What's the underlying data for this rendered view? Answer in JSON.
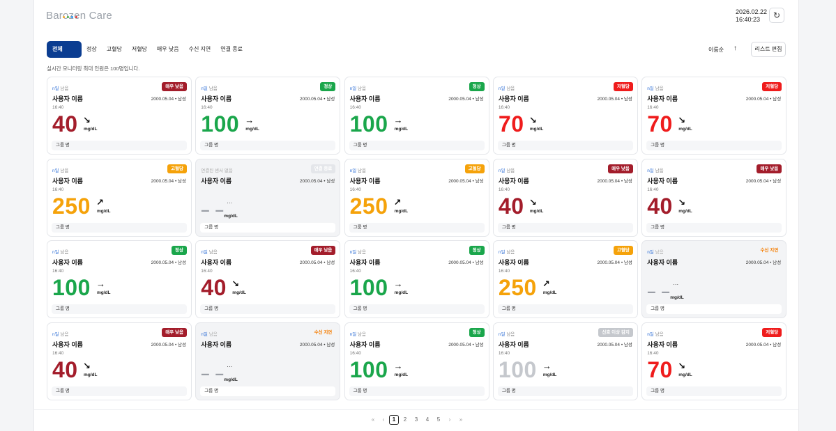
{
  "app": {
    "logo_text": "Barozen Care",
    "logo_dot_colors": [
      "#f5a623",
      "#4caf50",
      "#2196f3",
      "#e53935"
    ]
  },
  "header": {
    "date": "2026.02.22",
    "time": "16:40:23",
    "refresh_icon": "refresh-icon"
  },
  "tabs": [
    {
      "label": "전체",
      "active": true
    },
    {
      "label": "정상"
    },
    {
      "label": "고혈당"
    },
    {
      "label": "저혈당"
    },
    {
      "label": "매우 낮음"
    },
    {
      "label": "수신 지연"
    },
    {
      "label": "연결 종료"
    }
  ],
  "sort": {
    "label": "이름순",
    "direction_icon": "arrow-up-icon"
  },
  "edit_button": "리스트 편집",
  "notice": "실시간 모니터링 최대 인원은 100명입니다.",
  "colors": {
    "very_low": "#a31d2b",
    "normal": "#1aa64b",
    "low": "#ef1c1c",
    "high": "#f5a20a",
    "disconnected": "#cfd2d7",
    "delayed": "#f57c00",
    "out_of_range": "#c5c8cd"
  },
  "cards": [
    {
      "remain_n": "n일",
      "remain_t": "남음",
      "badge": "매우 낮음",
      "status": "very_low",
      "name": "사용자 이름",
      "birth": "2000.05.04 • 남성",
      "time": "16:40",
      "value": "40",
      "arrow": "↘",
      "unit": "mg/dL",
      "group": "그룹 명"
    },
    {
      "remain_n": "n일",
      "remain_t": "남음",
      "badge": "정상",
      "status": "normal",
      "name": "사용자 이름",
      "birth": "2000.05.04 • 남성",
      "time": "16:40",
      "value": "100",
      "arrow": "→",
      "unit": "mg/dL",
      "group": "그룹 명"
    },
    {
      "remain_n": "n일",
      "remain_t": "남음",
      "badge": "정상",
      "status": "normal",
      "name": "사용자 이름",
      "birth": "2000.05.04 • 남성",
      "time": "16:40",
      "value": "100",
      "arrow": "→",
      "unit": "mg/dL",
      "group": "그룹 명"
    },
    {
      "remain_n": "n일",
      "remain_t": "남음",
      "badge": "저혈당",
      "status": "low",
      "name": "사용자 이름",
      "birth": "2000.05.04 • 남성",
      "time": "16:40",
      "value": "70",
      "arrow": "↘",
      "unit": "mg/dL",
      "group": "그룹 명"
    },
    {
      "remain_n": "n일",
      "remain_t": "남음",
      "badge": "저혈당",
      "status": "low",
      "name": "사용자 이름",
      "birth": "2000.05.04 • 남성",
      "time": "16:40",
      "value": "70",
      "arrow": "↘",
      "unit": "mg/dL",
      "group": "그룹 명"
    },
    {
      "remain_n": "n일",
      "remain_t": "남음",
      "badge": "고혈당",
      "status": "high",
      "name": "사용자 이름",
      "birth": "2000.05.04 • 남성",
      "time": "16:40",
      "value": "250",
      "arrow": "↗",
      "unit": "mg/dL",
      "group": "그룹 명"
    },
    {
      "remain_n": "",
      "remain_t": "연결된 센서 없음",
      "badge": "연결 종료",
      "status": "disconnected",
      "name": "사용자 이름",
      "birth": "2000.05.04 • 남성",
      "time": "",
      "value": "",
      "dash": "– –",
      "arrow": "···",
      "unit": "mg/dL",
      "group": "그룹 명"
    },
    {
      "remain_n": "n일",
      "remain_t": "남음",
      "badge": "고혈당",
      "status": "high",
      "name": "사용자 이름",
      "birth": "2000.05.04 • 남성",
      "time": "16:40",
      "value": "250",
      "arrow": "↗",
      "unit": "mg/dL",
      "group": "그룹 명"
    },
    {
      "remain_n": "n일",
      "remain_t": "남음",
      "badge": "매우 낮음",
      "status": "very_low",
      "name": "사용자 이름",
      "birth": "2000.05.04 • 남성",
      "time": "16:40",
      "value": "40",
      "arrow": "↘",
      "unit": "mg/dL",
      "group": "그룹 명"
    },
    {
      "remain_n": "n일",
      "remain_t": "남음",
      "badge": "매우 낮음",
      "status": "very_low",
      "name": "사용자 이름",
      "birth": "2000.05.04 • 남성",
      "time": "16:40",
      "value": "40",
      "arrow": "↘",
      "unit": "mg/dL",
      "group": "그룹 명"
    },
    {
      "remain_n": "n일",
      "remain_t": "남음",
      "badge": "정상",
      "status": "normal",
      "name": "사용자 이름",
      "birth": "2000.05.04 • 남성",
      "time": "16:40",
      "value": "100",
      "arrow": "→",
      "unit": "mg/dL",
      "group": "그룹 명"
    },
    {
      "remain_n": "n일",
      "remain_t": "남음",
      "badge": "매우 낮음",
      "status": "very_low",
      "name": "사용자 이름",
      "birth": "2000.05.04 • 남성",
      "time": "16:40",
      "value": "40",
      "arrow": "↘",
      "unit": "mg/dL",
      "group": "그룹 명"
    },
    {
      "remain_n": "n일",
      "remain_t": "남음",
      "badge": "정상",
      "status": "normal",
      "name": "사용자 이름",
      "birth": "2000.05.04 • 남성",
      "time": "16:40",
      "value": "100",
      "arrow": "→",
      "unit": "mg/dL",
      "group": "그룹 명"
    },
    {
      "remain_n": "n일",
      "remain_t": "남음",
      "badge": "고혈당",
      "status": "high",
      "name": "사용자 이름",
      "birth": "2000.05.04 • 남성",
      "time": "16:40",
      "value": "250",
      "arrow": "↗",
      "unit": "mg/dL",
      "group": "그룹 명"
    },
    {
      "remain_n": "n일",
      "remain_t": "남음",
      "badge": "수신 지연",
      "status": "delayed",
      "name": "사용자 이름",
      "birth": "2000.05.04 • 남성",
      "time": "",
      "value": "",
      "dash": "– –",
      "arrow": "···",
      "unit": "mg/dL",
      "group": "그룹 명"
    },
    {
      "remain_n": "n일",
      "remain_t": "남음",
      "badge": "매우 낮음",
      "status": "very_low",
      "name": "사용자 이름",
      "birth": "2000.05.04 • 남성",
      "time": "16:40",
      "value": "40",
      "arrow": "↘",
      "unit": "mg/dL",
      "group": "그룹 명"
    },
    {
      "remain_n": "n일",
      "remain_t": "남음",
      "badge": "수신 지연",
      "status": "delayed",
      "name": "사용자 이름",
      "birth": "2000.05.04 • 남성",
      "time": "",
      "value": "",
      "dash": "– –",
      "arrow": "···",
      "unit": "mg/dL",
      "group": "그룹 명"
    },
    {
      "remain_n": "n일",
      "remain_t": "남음",
      "badge": "정상",
      "status": "normal",
      "name": "사용자 이름",
      "birth": "2000.05.04 • 남성",
      "time": "16:40",
      "value": "100",
      "arrow": "→",
      "unit": "mg/dL",
      "group": "그룹 명"
    },
    {
      "remain_n": "n일",
      "remain_t": "남음",
      "badge": "신호 이상 감지",
      "status": "out_of_range",
      "name": "사용자 이름",
      "birth": "2000.05.04 • 남성",
      "time": "16:40",
      "value": "100",
      "arrow": "→",
      "unit": "mg/dL",
      "group": "그룹 명"
    },
    {
      "remain_n": "n일",
      "remain_t": "남음",
      "badge": "저혈당",
      "status": "low",
      "name": "사용자 이름",
      "birth": "2000.05.04 • 남성",
      "time": "16:40",
      "value": "70",
      "arrow": "↘",
      "unit": "mg/dL",
      "group": "그룹 명"
    }
  ],
  "pagination": {
    "first_icon": "double-chevron-left-icon",
    "prev_icon": "chevron-left-icon",
    "pages": [
      "1",
      "2",
      "3",
      "4",
      "5"
    ],
    "current": "1",
    "next_icon": "chevron-right-icon",
    "last_icon": "double-chevron-right-icon"
  }
}
